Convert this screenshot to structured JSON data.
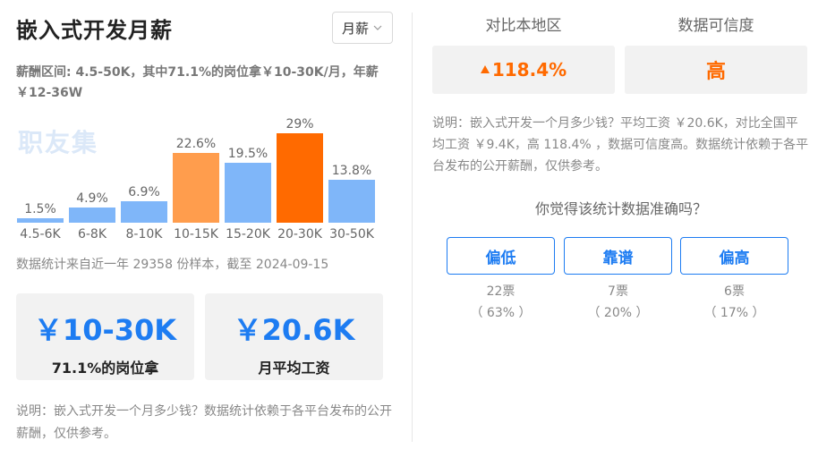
{
  "title": "嵌入式开发月薪",
  "period_select": {
    "value": "月薪",
    "icon": "chevron-down-icon"
  },
  "range_text": "薪酬区间: 4.5-50K，其中71.1%的岗位拿￥10-30K/月，年薪￥12-36W",
  "watermark": "职友集",
  "chart_data": {
    "type": "bar",
    "categories": [
      "4.5-6K",
      "6-8K",
      "8-10K",
      "10-15K",
      "15-20K",
      "20-30K",
      "30-50K"
    ],
    "values": [
      1.5,
      4.9,
      6.9,
      22.6,
      19.5,
      29,
      13.8
    ],
    "value_labels": [
      "1.5%",
      "4.9%",
      "6.9%",
      "22.6%",
      "19.5%",
      "29%",
      "13.8%"
    ],
    "colors": [
      "#7fb6f9",
      "#7fb6f9",
      "#7fb6f9",
      "#ff9d4d",
      "#7fb6f9",
      "#ff6a00",
      "#7fb6f9"
    ],
    "ylim": [
      0,
      29
    ]
  },
  "sample_note": "数据统计来自近一年 29358 份样本，截至 2024-09-15",
  "cards": [
    {
      "value": "￥10-30K",
      "label": "71.1%的岗位拿"
    },
    {
      "value": "￥20.6K",
      "label": "月平均工资"
    }
  ],
  "left_explain": "说明：嵌入式开发一个月多少钱？数据统计依赖于各平台发布的公开薪酬，仅供参考。",
  "compare": {
    "label": "对比本地区",
    "value": "118.4%",
    "icon": "arrow-up-icon",
    "color": "#ff6a00"
  },
  "reliability": {
    "label": "数据可信度",
    "value": "高"
  },
  "right_explain": "说明：嵌入式开发一个月多少钱？平均工资 ￥20.6K，对比全国平均工资 ￥9.4K，高 118.4% ，数据可信度高。数据统计依赖于各平台发布的公开薪酬，仅供参考。",
  "poll": {
    "question": "你觉得该统计数据准确吗？",
    "options": [
      {
        "label": "偏低",
        "votes": "22票",
        "percent": "（ 63% ）"
      },
      {
        "label": "靠谱",
        "votes": "7票",
        "percent": "（ 20% ）"
      },
      {
        "label": "偏高",
        "votes": "6票",
        "percent": "（ 17% ）"
      }
    ]
  },
  "colors": {
    "accent": "#1d7cf2",
    "highlight": "#ff6a00",
    "bar": "#7fb6f9",
    "bar_secondary": "#ff9d4d"
  }
}
